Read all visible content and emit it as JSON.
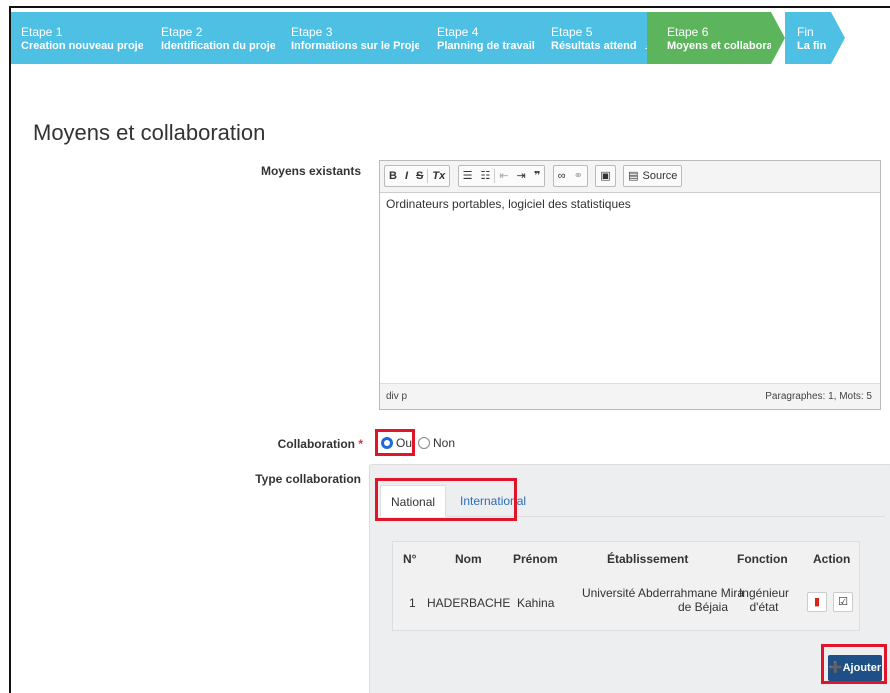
{
  "colors": {
    "wizard_blue": "#4ec0e4",
    "wizard_green": "#5cb55c",
    "primary": "#1e4f86",
    "link": "#2a6fb4",
    "danger": "#e0152a"
  },
  "wizard": {
    "steps": [
      {
        "num": "Etape 1",
        "label": "Creation nouveau projet"
      },
      {
        "num": "Etape 2",
        "label": "Identification du projet"
      },
      {
        "num": "Etape 3",
        "label": "Informations sur le Projet"
      },
      {
        "num": "Etape 4",
        "label": "Planning de travail"
      },
      {
        "num": "Etape 5",
        "label": "Résultats attendus"
      },
      {
        "num": "Etape 6",
        "label": "Moyens et collaboration"
      },
      {
        "num": "Fin",
        "label": "La fin"
      }
    ],
    "active_step": 5
  },
  "page_title": "Moyens et collaboration",
  "moyens": {
    "label": "Moyens existants",
    "toolbar": {
      "bold": "B",
      "italic": "I",
      "strike": "S",
      "clear": "Tx",
      "source": "Source"
    },
    "content": "Ordinateurs portables, logiciel des statistiques",
    "path": "div  p",
    "stats": "Paragraphes: 1, Mots: 5"
  },
  "collaboration": {
    "label": "Collaboration",
    "required_mark": "*",
    "options": [
      "Oui",
      "Non"
    ],
    "selected": "Oui"
  },
  "type_collaboration": {
    "label": "Type collaboration",
    "tabs": [
      "National",
      "International"
    ],
    "active_tab": "National",
    "table": {
      "headers": [
        "N°",
        "Nom",
        "Prénom",
        "Établissement",
        "Fonction",
        "Action"
      ],
      "rows": [
        {
          "n": "1",
          "nom": "HADERBACHE",
          "prenom": "Kahina",
          "etab_line1": "Université Abderrahmane Mira",
          "etab_line2": "de Béjaia",
          "fonction_line1": "Ingénieur",
          "fonction_line2": "d'état"
        }
      ]
    },
    "add_button": "Ajouter"
  }
}
